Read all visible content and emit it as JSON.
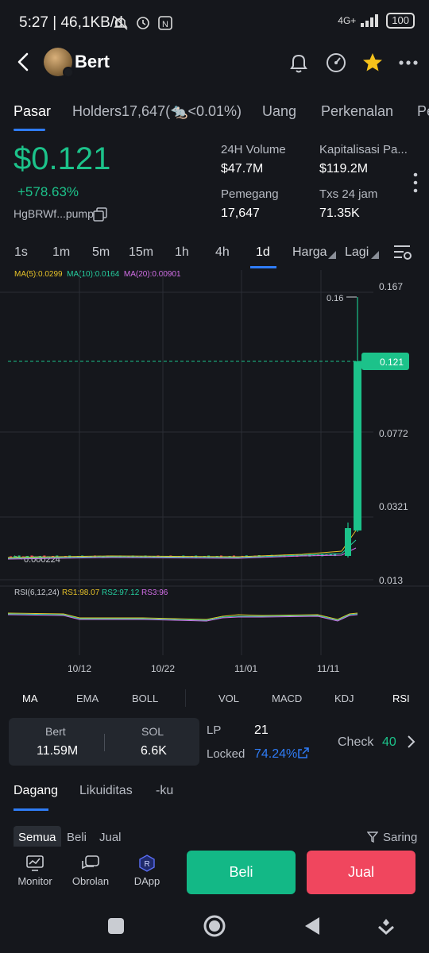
{
  "status_bar": {
    "time": "5:27 | 46,1KB/d",
    "network": "4G+",
    "battery": "100"
  },
  "header": {
    "title": "Bert",
    "icons": [
      "back-arrow-icon",
      "bell-icon",
      "gauge-icon",
      "star-icon",
      "more-icon"
    ]
  },
  "tabs": [
    {
      "label": "Pasar"
    },
    {
      "label": "Holders17,647(🐀<0.01%)"
    },
    {
      "label": "Uang"
    },
    {
      "label": "Perkenalan"
    },
    {
      "label": "Pe"
    }
  ],
  "token": {
    "price": "$0.121",
    "change": "+578.63%",
    "address": "HgBRWf...pump"
  },
  "stats": [
    {
      "label": "24H Volume",
      "value": "$47.7M"
    },
    {
      "label": "Kapitalisasi Pa...",
      "value": "$119.2M"
    },
    {
      "label": "Pemegang",
      "value": "17,647"
    },
    {
      "label": "Txs 24 jam",
      "value": "71.35K"
    }
  ],
  "intervals": [
    "1s",
    "1m",
    "5m",
    "15m",
    "1h",
    "4h",
    "1d",
    "Harga",
    "Lagi"
  ],
  "active_interval": "1d",
  "ma_legend": {
    "ma5": "MA(5):0.0299",
    "ma10": "MA(10):0.0164",
    "ma20": "MA(20):0.00901",
    "colors": {
      "ma5": "#e6c229",
      "ma10": "#25d0a0",
      "ma20": "#d36fe8"
    }
  },
  "chart_data": {
    "type": "candlestick",
    "y_axis_labels": [
      "0.167",
      "0.0772",
      "0.0321",
      "0.013"
    ],
    "current_price_label": "0.121",
    "current_price": 0.121,
    "high_label": "0.16",
    "low_label": "0.000224",
    "x_labels": [
      "10/12",
      "10/22",
      "11/01",
      "11/11"
    ],
    "candles": [
      {
        "x": "early",
        "open": 0.00025,
        "close": 0.00024
      },
      {
        "x": "mid",
        "open": 0.00022,
        "close": 0.00023
      },
      {
        "x": "11/13",
        "open": 0.0009,
        "close": 0.0182
      },
      {
        "x": "11/14",
        "open": 0.0182,
        "close": 0.121,
        "high": 0.16
      }
    ],
    "colors": {
      "up": "#1cc28a",
      "down": "#f0465e",
      "grid": "#2a2e35"
    }
  },
  "rsi_legend": {
    "title": "RSI(6,12,24)",
    "rs1": "RS1:98.07",
    "rs2": "RS2:97.12",
    "rs3": "RS3:96"
  },
  "indicators": [
    "MA",
    "EMA",
    "BOLL",
    "VOL",
    "MACD",
    "KDJ",
    "RSI"
  ],
  "liquidity": {
    "token_name": "Bert",
    "token_amount": "11.59M",
    "pair_name": "SOL",
    "pair_amount": "6.6K",
    "lp_label": "LP",
    "lp_value": "21",
    "locked_label": "Locked",
    "locked_value": "74.24%",
    "check_label": "Check",
    "check_value": "40"
  },
  "subtabs": [
    "Dagang",
    "Likuiditas",
    "-ku"
  ],
  "filters": [
    "Semua",
    "Beli",
    "Jual"
  ],
  "filter_right": "Saring",
  "bottom_nav": [
    "Monitor",
    "Obrolan",
    "DApp"
  ],
  "buy_label": "Beli",
  "sell_label": "Jual",
  "accent": {
    "green": "#1cc28a",
    "red": "#f0465e",
    "blue": "#2f7cf6",
    "yellow": "#f5c21b"
  }
}
